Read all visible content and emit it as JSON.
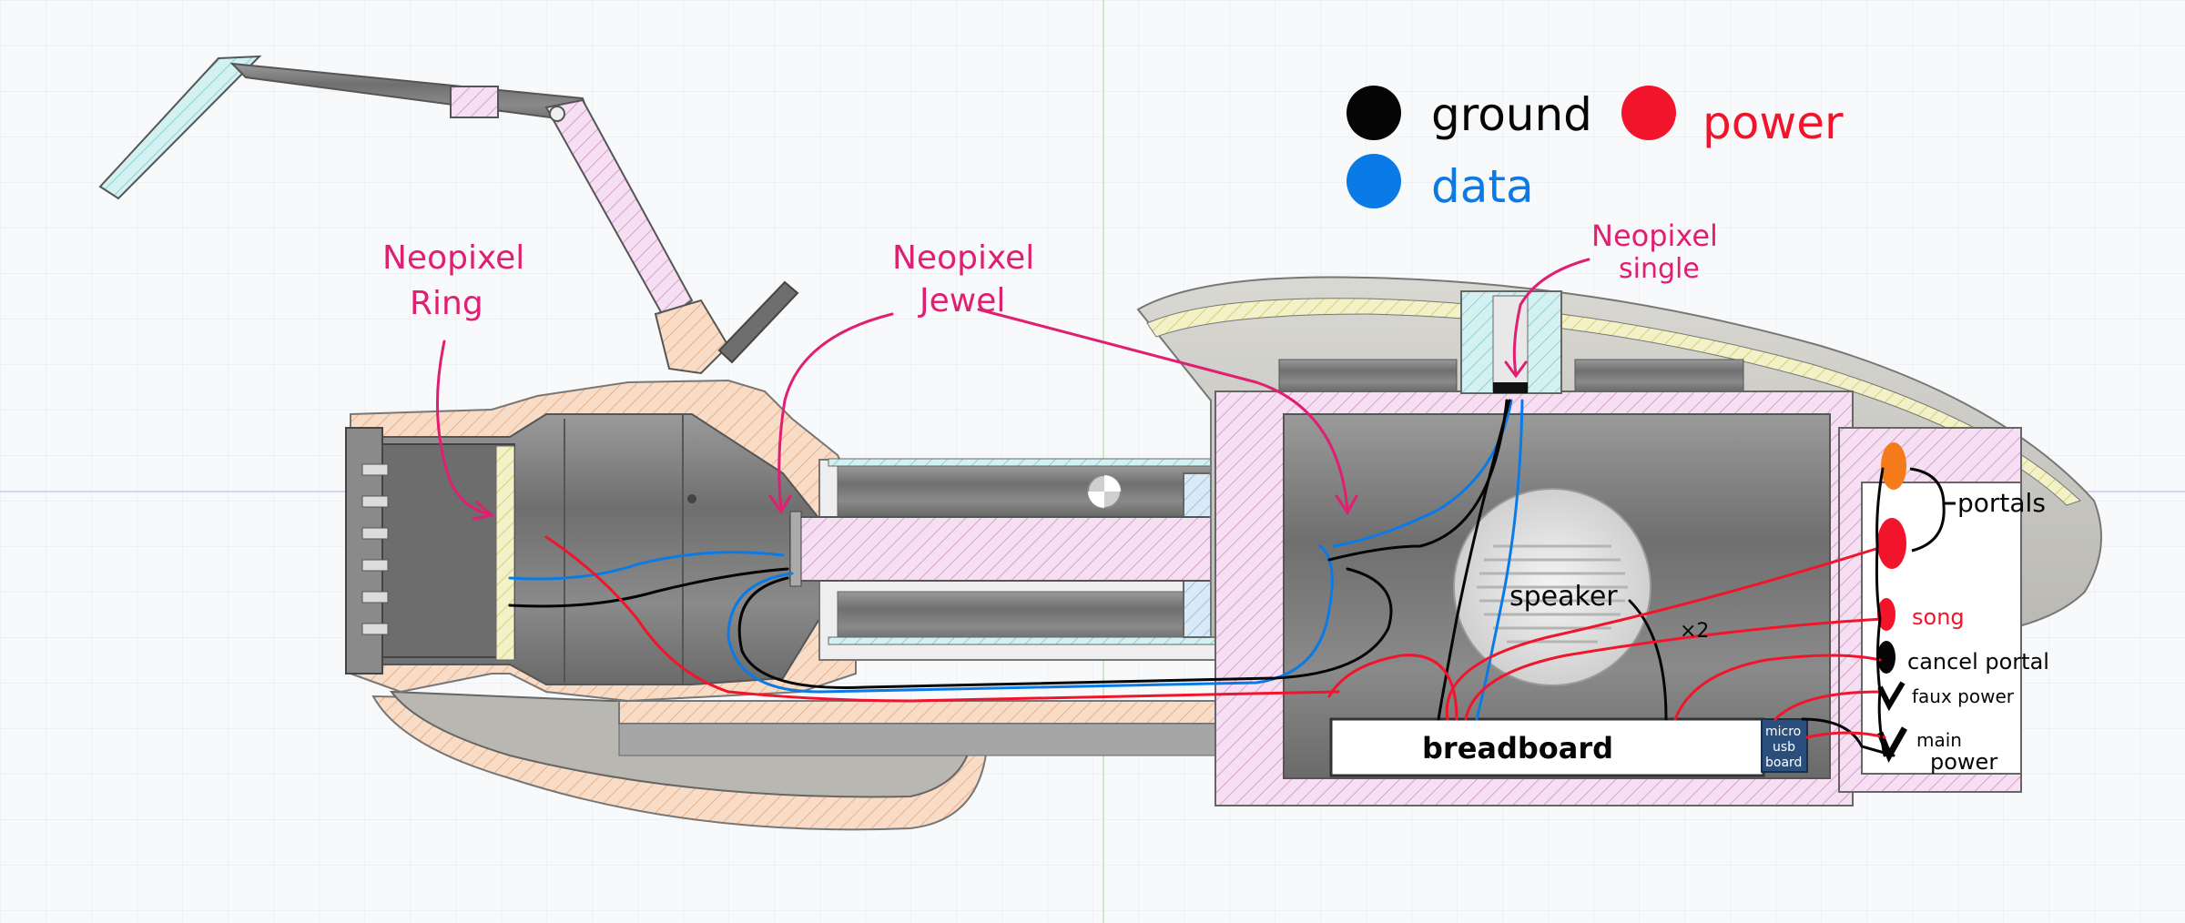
{
  "legend": {
    "ground": {
      "label": "ground",
      "color": "#050505"
    },
    "data": {
      "label": "data",
      "color": "#0a7be6"
    },
    "power": {
      "label": "power",
      "color": "#f2142b"
    }
  },
  "annotations": {
    "neopixel_ring": {
      "line1": "Neopixel",
      "line2": "Ring"
    },
    "neopixel_jewel": {
      "line1": "Neopixel",
      "line2": "Jewel"
    },
    "neopixel_single": {
      "line1": "Neopixel",
      "line2": "single"
    },
    "annotation_color": "#e01e72"
  },
  "components": {
    "breadboard": "breadboard",
    "speaker": "speaker",
    "speaker_count": "×2",
    "micro_usb_board": {
      "line1": "micro",
      "line2": "usb",
      "line3": "board"
    }
  },
  "switches": {
    "portals": "portals",
    "song": "song",
    "cancel_portal": "cancel portal",
    "faux_power": "faux power",
    "main_power": {
      "line1": "main",
      "line2": "power"
    }
  },
  "colors": {
    "background": "#f8f9fa",
    "grid": "#e3e6ea",
    "cad_gray": "#7d7d7d",
    "hatch_pink": "#e8b9e0",
    "hatch_peach": "#f4c9a8",
    "hatch_cyan": "#a9e2e4",
    "hatch_yellow": "#e8e49a",
    "hatch_blue": "#b9d6ee",
    "orange_button": "#f47a1a"
  }
}
